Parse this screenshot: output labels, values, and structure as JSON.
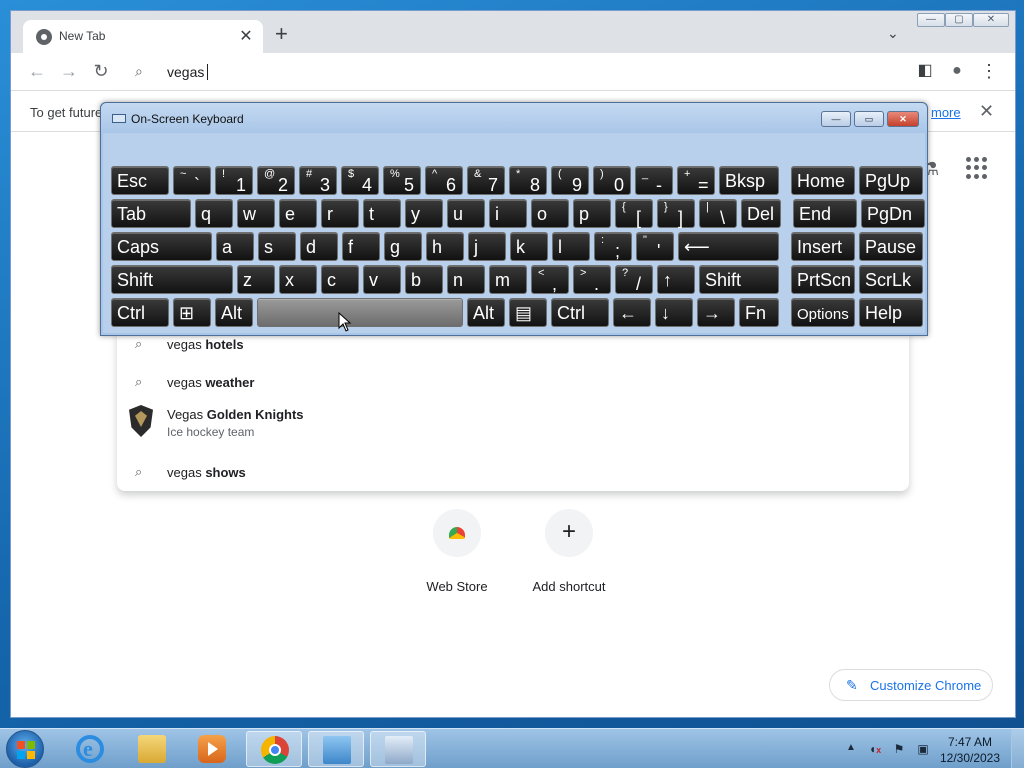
{
  "browser": {
    "tab_title": "New Tab",
    "tab_close": "✕",
    "new_tab": "+",
    "tab_search": "⌄",
    "window_controls": {
      "minimize": "—",
      "maximize": "▢",
      "close": "✕"
    },
    "nav": {
      "back": "←",
      "forward": "→",
      "reload": "↻"
    },
    "omnibox": {
      "search_icon": "⌕",
      "query": "vegas"
    },
    "side_panel_icon": "◧",
    "profile_icon": "●",
    "menu_icon": "⋮"
  },
  "infobar": {
    "text": "To get future",
    "link": "more",
    "close": "✕"
  },
  "ntp": {
    "lab_icon": "⚗"
  },
  "suggestions": {
    "items": [
      {
        "icon": "⌕",
        "prefix": "vegas ",
        "bold": "hotels"
      },
      {
        "icon": "⌕",
        "prefix": "vegas ",
        "bold": "weather"
      },
      {
        "icon": "",
        "prefix": "Vegas ",
        "bold": "Golden Knights",
        "subtitle": "Ice hockey team"
      },
      {
        "icon": "⌕",
        "prefix": "vegas ",
        "bold": "shows"
      }
    ]
  },
  "shortcuts": [
    {
      "label": "Web Store"
    },
    {
      "label": "Add shortcut",
      "plus": "+"
    }
  ],
  "customize": {
    "icon": "✎",
    "label": "Customize Chrome"
  },
  "osk": {
    "title": "On-Screen Keyboard",
    "controls": {
      "minimize": "—",
      "restore": "▭",
      "close": "✕"
    },
    "rows": [
      [
        {
          "main": "Esc",
          "w": 58
        },
        {
          "small": "~",
          "big": "`",
          "w": 38
        },
        {
          "small": "!",
          "big": "1",
          "w": 38
        },
        {
          "small": "@",
          "big": "2",
          "w": 38
        },
        {
          "small": "#",
          "big": "3",
          "w": 38
        },
        {
          "small": "$",
          "big": "4",
          "w": 38
        },
        {
          "small": "%",
          "big": "5",
          "w": 38
        },
        {
          "small": "^",
          "big": "6",
          "w": 38
        },
        {
          "small": "&",
          "big": "7",
          "w": 38
        },
        {
          "small": "*",
          "big": "8",
          "w": 38
        },
        {
          "small": "(",
          "big": "9",
          "w": 38
        },
        {
          "small": ")",
          "big": "0",
          "w": 38
        },
        {
          "small": "_",
          "big": "-",
          "w": 38
        },
        {
          "small": "+",
          "big": "=",
          "w": 38
        },
        {
          "main": "Bksp",
          "w": 60
        },
        {
          "main": "Home",
          "w": 64,
          "gap": 8
        },
        {
          "main": "PgUp",
          "w": 64
        }
      ],
      [
        {
          "main": "Tab",
          "w": 80
        },
        {
          "main": "q",
          "w": 38
        },
        {
          "main": "w",
          "w": 38
        },
        {
          "main": "e",
          "w": 38
        },
        {
          "main": "r",
          "w": 38
        },
        {
          "main": "t",
          "w": 38
        },
        {
          "main": "y",
          "w": 38
        },
        {
          "main": "u",
          "w": 38
        },
        {
          "main": "i",
          "w": 38
        },
        {
          "main": "o",
          "w": 38
        },
        {
          "main": "p",
          "w": 38
        },
        {
          "small": "{",
          "big": "[",
          "w": 38
        },
        {
          "small": "}",
          "big": "]",
          "w": 38
        },
        {
          "small": "|",
          "big": "\\",
          "w": 38
        },
        {
          "main": "Del",
          "w": 40
        },
        {
          "main": "End",
          "w": 64,
          "gap": 8
        },
        {
          "main": "PgDn",
          "w": 64
        }
      ],
      [
        {
          "main": "Caps",
          "w": 101
        },
        {
          "main": "a",
          "w": 38
        },
        {
          "main": "s",
          "w": 38
        },
        {
          "main": "d",
          "w": 38
        },
        {
          "main": "f",
          "w": 38
        },
        {
          "main": "g",
          "w": 38
        },
        {
          "main": "h",
          "w": 38
        },
        {
          "main": "j",
          "w": 38
        },
        {
          "main": "k",
          "w": 38
        },
        {
          "main": "l",
          "w": 38
        },
        {
          "small": ":",
          "big": ";",
          "w": 38
        },
        {
          "small": "\"",
          "big": "'",
          "w": 38
        },
        {
          "main": "⟵",
          "w": 101
        },
        {
          "main": "Insert",
          "w": 64,
          "gap": 8
        },
        {
          "main": "Pause",
          "w": 64
        }
      ],
      [
        {
          "main": "Shift",
          "w": 122
        },
        {
          "main": "z",
          "w": 38
        },
        {
          "main": "x",
          "w": 38
        },
        {
          "main": "c",
          "w": 38
        },
        {
          "main": "v",
          "w": 38
        },
        {
          "main": "b",
          "w": 38
        },
        {
          "main": "n",
          "w": 38
        },
        {
          "main": "m",
          "w": 38
        },
        {
          "small": "<",
          "big": ",",
          "w": 38
        },
        {
          "small": ">",
          "big": ".",
          "w": 38
        },
        {
          "small": "?",
          "big": "/",
          "w": 38
        },
        {
          "main": "↑",
          "w": 38
        },
        {
          "main": "Shift",
          "w": 80
        },
        {
          "main": "PrtScn",
          "w": 64,
          "gap": 8
        },
        {
          "main": "ScrLk",
          "w": 64
        }
      ],
      [
        {
          "main": "Ctrl",
          "w": 58
        },
        {
          "main": "⊞",
          "w": 38
        },
        {
          "main": "Alt",
          "w": 38
        },
        {
          "main": "",
          "w": 206,
          "space": true
        },
        {
          "main": "Alt",
          "w": 38
        },
        {
          "main": "▤",
          "w": 38
        },
        {
          "main": "Ctrl",
          "w": 58
        },
        {
          "main": "←",
          "w": 38
        },
        {
          "main": "↓",
          "w": 38
        },
        {
          "main": "→",
          "w": 38
        },
        {
          "main": "Fn",
          "w": 40
        },
        {
          "main": "Options",
          "w": 64,
          "gap": 8
        },
        {
          "main": "Help",
          "w": 64
        }
      ]
    ]
  },
  "taskbar": {
    "items": [
      "internet-explorer",
      "file-explorer",
      "media-center",
      "chrome",
      "control-panel",
      "on-screen-keyboard"
    ],
    "tray": {
      "arrow": "▲",
      "time": "7:47 AM",
      "date": "12/30/2023"
    }
  }
}
